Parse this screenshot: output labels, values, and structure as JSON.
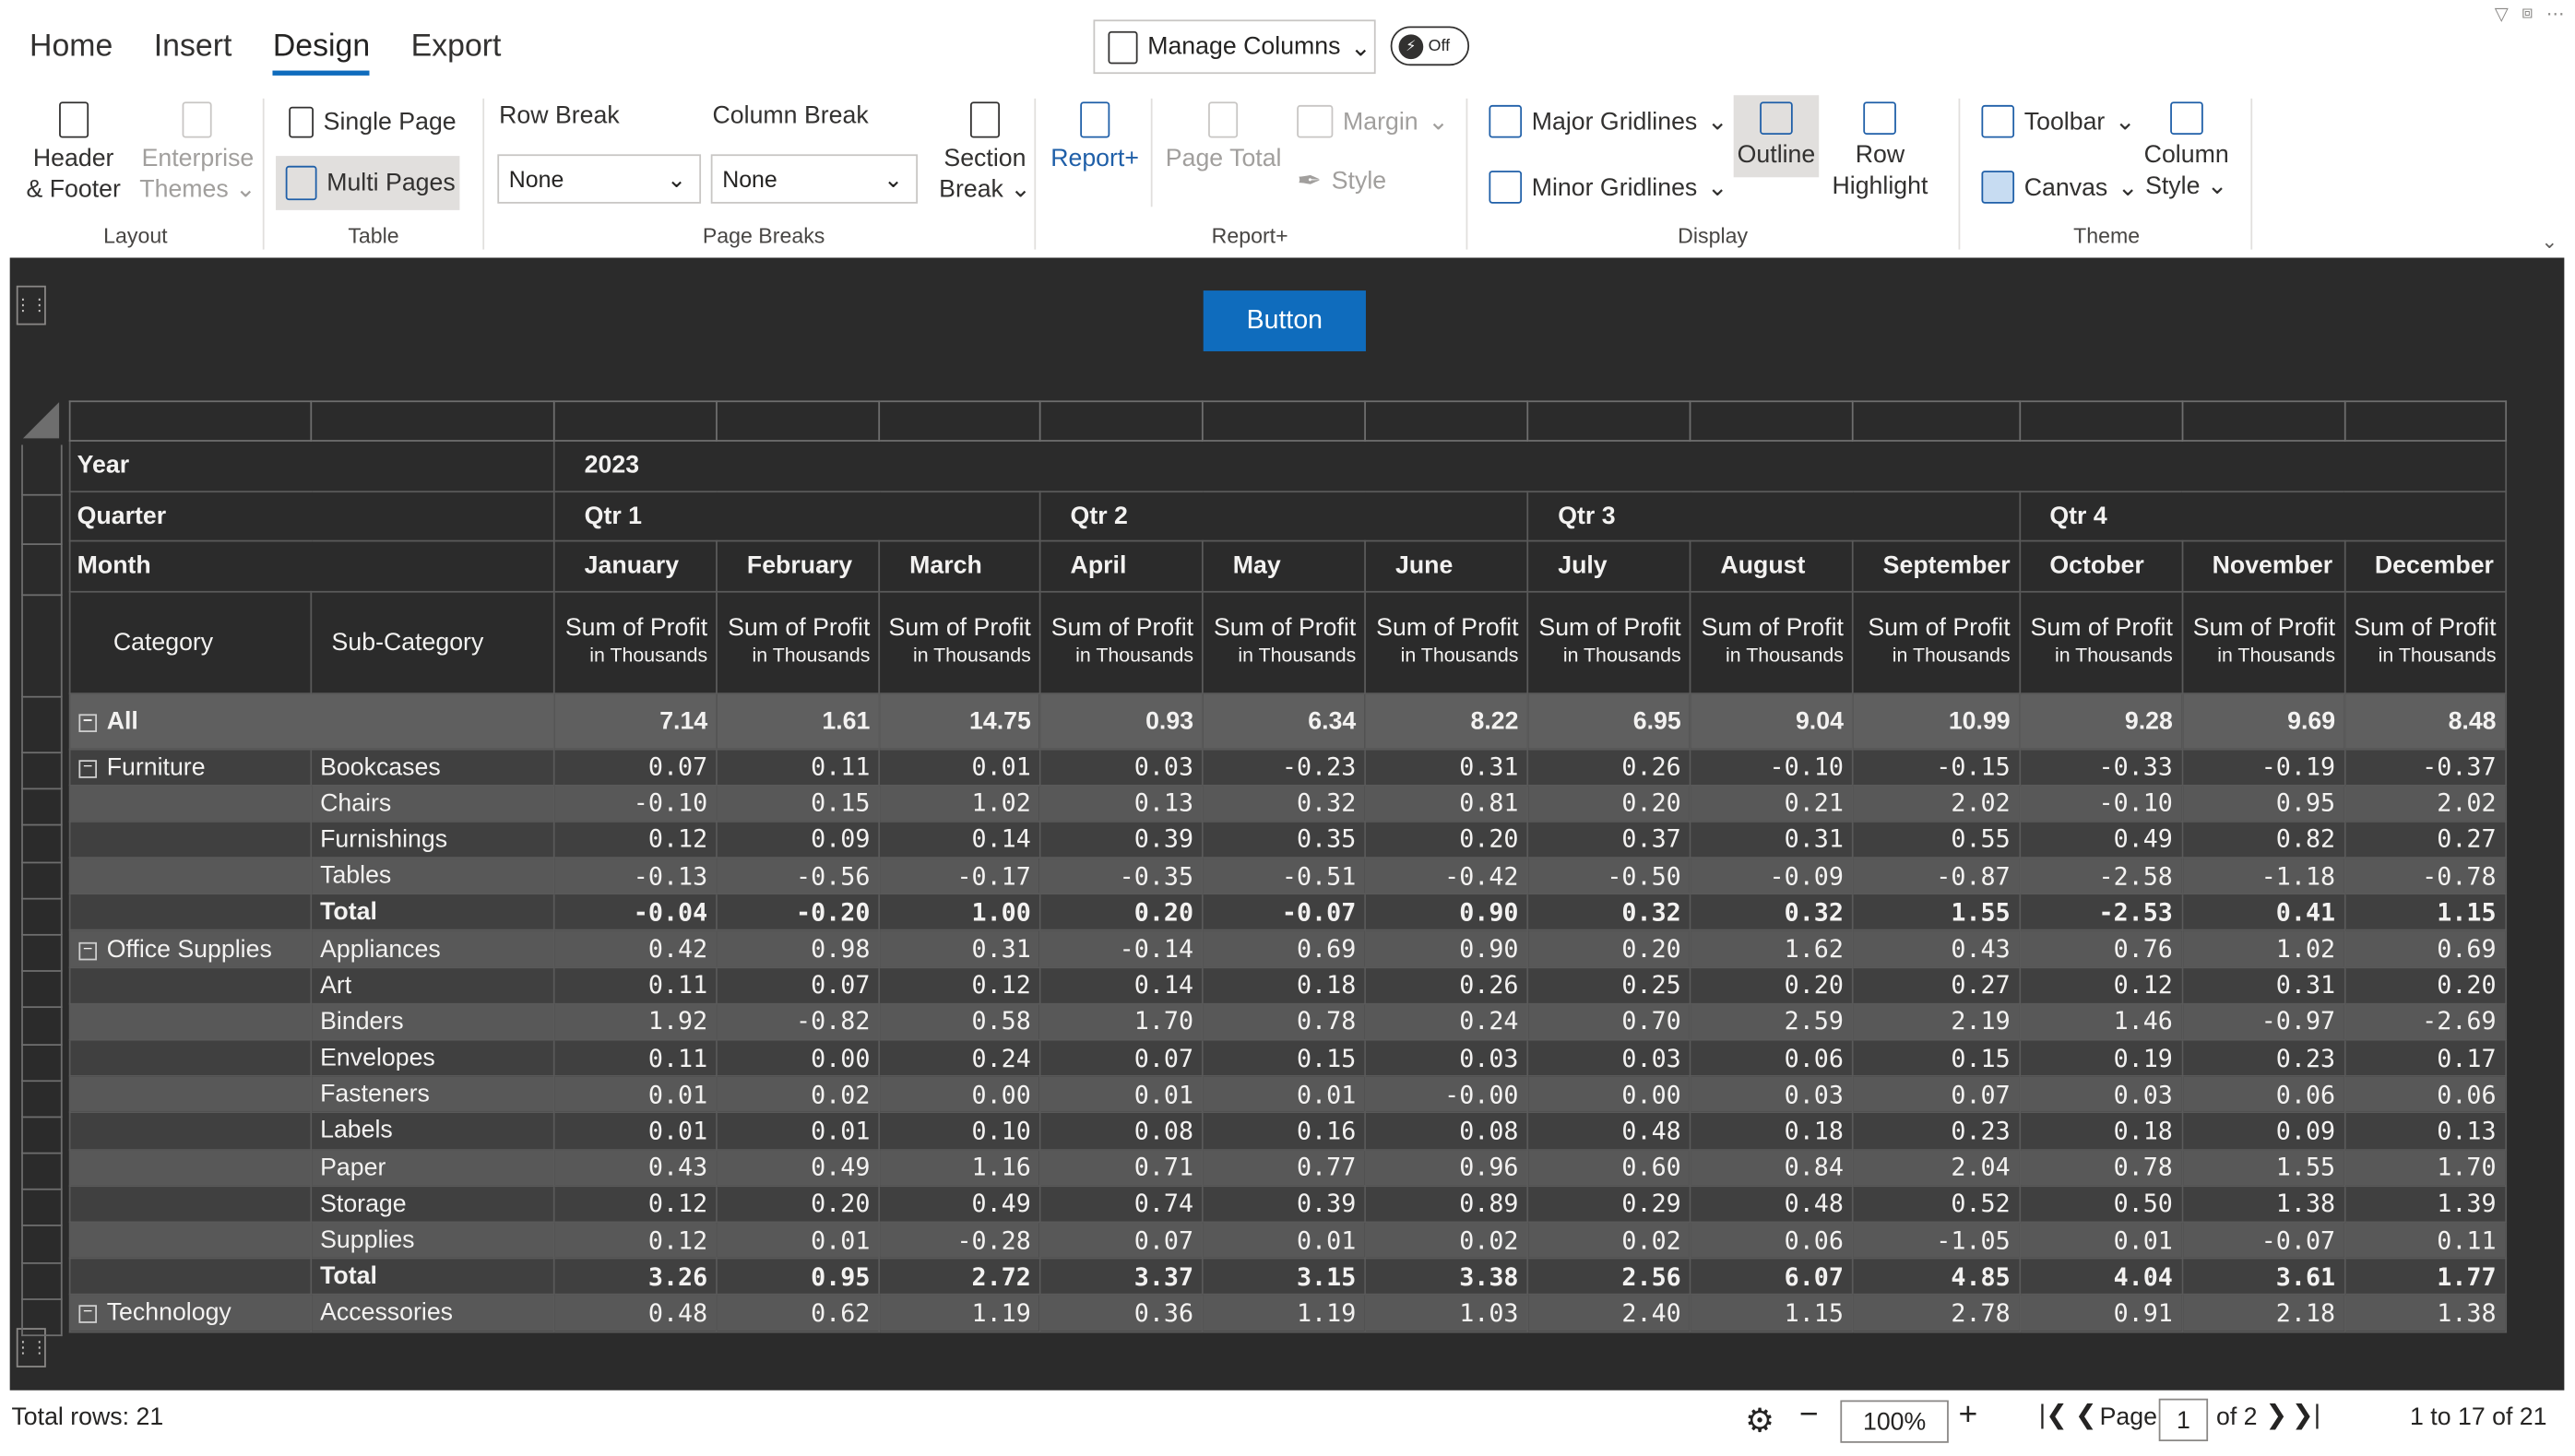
{
  "tabs": [
    "Home",
    "Insert",
    "Design",
    "Export"
  ],
  "active_tab": "Design",
  "manage_columns": "Manage Columns",
  "toggle_label": "Off",
  "ribbon": {
    "layout": {
      "header_footer": [
        "Header",
        "& Footer"
      ],
      "enterprise_themes": [
        "Enterprise",
        "Themes"
      ],
      "group": "Layout"
    },
    "table": {
      "single_page": "Single Page",
      "multi_pages": "Multi Pages",
      "group": "Table"
    },
    "page_breaks": {
      "row_break_label": "Row Break",
      "row_break_value": "None",
      "column_break_label": "Column Break",
      "column_break_value": "None",
      "section_break": [
        "Section",
        "Break"
      ],
      "group": "Page Breaks"
    },
    "reportplus": {
      "report": "Report+",
      "page_total": "Page Total",
      "margin": "Margin",
      "style": "Style",
      "group": "Report+"
    },
    "display": {
      "major": "Major Gridlines",
      "minor": "Minor Gridlines",
      "outline": "Outline",
      "row_highlight": [
        "Row",
        "Highlight"
      ],
      "group": "Display"
    },
    "theme": {
      "toolbar": "Toolbar",
      "canvas": "Canvas",
      "column_style": [
        "Column",
        "Style"
      ],
      "group": "Theme"
    }
  },
  "canvas_button": "Button",
  "pivot": {
    "hdr": {
      "year_label": "Year",
      "year": "2023",
      "quarter_label": "Quarter",
      "month_label": "Month",
      "quarters": [
        "Qtr 1",
        "Qtr 2",
        "Qtr 3",
        "Qtr 4"
      ],
      "months": [
        "January",
        "February",
        "March",
        "April",
        "May",
        "June",
        "July",
        "August",
        "September",
        "October",
        "November",
        "December"
      ],
      "category": "Category",
      "subcategory": "Sub-Category",
      "measure": "Sum of Profit",
      "measure_unit": "in Thousands"
    },
    "rows": [
      {
        "cat": "All",
        "sub": "",
        "type": "all",
        "v": [
          "7.14",
          "1.61",
          "14.75",
          "0.93",
          "6.34",
          "8.22",
          "6.95",
          "9.04",
          "10.99",
          "9.28",
          "9.69",
          "8.48"
        ]
      },
      {
        "cat": "Furniture",
        "sub": "Bookcases",
        "type": "odd",
        "v": [
          "0.07",
          "0.11",
          "0.01",
          "0.03",
          "-0.23",
          "0.31",
          "0.26",
          "-0.10",
          "-0.15",
          "-0.33",
          "-0.19",
          "-0.37"
        ]
      },
      {
        "cat": "",
        "sub": "Chairs",
        "type": "even",
        "v": [
          "-0.10",
          "0.15",
          "1.02",
          "0.13",
          "0.32",
          "0.81",
          "0.20",
          "0.21",
          "2.02",
          "-0.10",
          "0.95",
          "2.02"
        ]
      },
      {
        "cat": "",
        "sub": "Furnishings",
        "type": "odd",
        "v": [
          "0.12",
          "0.09",
          "0.14",
          "0.39",
          "0.35",
          "0.20",
          "0.37",
          "0.31",
          "0.55",
          "0.49",
          "0.82",
          "0.27"
        ]
      },
      {
        "cat": "",
        "sub": "Tables",
        "type": "even",
        "v": [
          "-0.13",
          "-0.56",
          "-0.17",
          "-0.35",
          "-0.51",
          "-0.42",
          "-0.50",
          "-0.09",
          "-0.87",
          "-2.58",
          "-1.18",
          "-0.78"
        ]
      },
      {
        "cat": "",
        "sub": "Total",
        "type": "odd tot",
        "v": [
          "-0.04",
          "-0.20",
          "1.00",
          "0.20",
          "-0.07",
          "0.90",
          "0.32",
          "0.32",
          "1.55",
          "-2.53",
          "0.41",
          "1.15"
        ]
      },
      {
        "cat": "Office Supplies",
        "sub": "Appliances",
        "type": "even",
        "v": [
          "0.42",
          "0.98",
          "0.31",
          "-0.14",
          "0.69",
          "0.90",
          "0.20",
          "1.62",
          "0.43",
          "0.76",
          "1.02",
          "0.69"
        ]
      },
      {
        "cat": "",
        "sub": "Art",
        "type": "odd",
        "v": [
          "0.11",
          "0.07",
          "0.12",
          "0.14",
          "0.18",
          "0.26",
          "0.25",
          "0.20",
          "0.27",
          "0.12",
          "0.31",
          "0.20"
        ]
      },
      {
        "cat": "",
        "sub": "Binders",
        "type": "even",
        "v": [
          "1.92",
          "-0.82",
          "0.58",
          "1.70",
          "0.78",
          "0.24",
          "0.70",
          "2.59",
          "2.19",
          "1.46",
          "-0.97",
          "-2.69"
        ]
      },
      {
        "cat": "",
        "sub": "Envelopes",
        "type": "odd",
        "v": [
          "0.11",
          "0.00",
          "0.24",
          "0.07",
          "0.15",
          "0.03",
          "0.03",
          "0.06",
          "0.15",
          "0.19",
          "0.23",
          "0.17"
        ]
      },
      {
        "cat": "",
        "sub": "Fasteners",
        "type": "even",
        "v": [
          "0.01",
          "0.02",
          "0.00",
          "0.01",
          "0.01",
          "-0.00",
          "0.00",
          "0.03",
          "0.07",
          "0.03",
          "0.06",
          "0.06"
        ]
      },
      {
        "cat": "",
        "sub": "Labels",
        "type": "odd",
        "v": [
          "0.01",
          "0.01",
          "0.10",
          "0.08",
          "0.16",
          "0.08",
          "0.48",
          "0.18",
          "0.23",
          "0.18",
          "0.09",
          "0.13"
        ]
      },
      {
        "cat": "",
        "sub": "Paper",
        "type": "even",
        "v": [
          "0.43",
          "0.49",
          "1.16",
          "0.71",
          "0.77",
          "0.96",
          "0.60",
          "0.84",
          "2.04",
          "0.78",
          "1.55",
          "1.70"
        ]
      },
      {
        "cat": "",
        "sub": "Storage",
        "type": "odd",
        "v": [
          "0.12",
          "0.20",
          "0.49",
          "0.74",
          "0.39",
          "0.89",
          "0.29",
          "0.48",
          "0.52",
          "0.50",
          "1.38",
          "1.39"
        ]
      },
      {
        "cat": "",
        "sub": "Supplies",
        "type": "even",
        "v": [
          "0.12",
          "0.01",
          "-0.28",
          "0.07",
          "0.01",
          "0.02",
          "0.02",
          "0.06",
          "-1.05",
          "0.01",
          "-0.07",
          "0.11"
        ]
      },
      {
        "cat": "",
        "sub": "Total",
        "type": "odd tot",
        "v": [
          "3.26",
          "0.95",
          "2.72",
          "3.37",
          "3.15",
          "3.38",
          "2.56",
          "6.07",
          "4.85",
          "4.04",
          "3.61",
          "1.77"
        ]
      },
      {
        "cat": "Technology",
        "sub": "Accessories",
        "type": "even",
        "v": [
          "0.48",
          "0.62",
          "1.19",
          "0.36",
          "1.19",
          "1.03",
          "2.40",
          "1.15",
          "2.78",
          "0.91",
          "2.18",
          "1.38"
        ]
      }
    ]
  },
  "status": {
    "total_rows": "Total rows: 21",
    "zoom": "100%",
    "page_label": "Page",
    "page": "1",
    "of_pages": "of 2",
    "range": "1 to 17 of 21"
  }
}
